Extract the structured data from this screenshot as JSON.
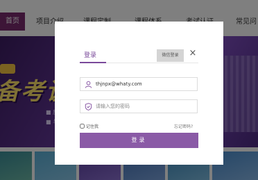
{
  "nav": {
    "home_label": "首页",
    "items": [
      "项目介绍",
      "课程定制",
      "课程体系",
      "考试认证",
      "常见问"
    ]
  },
  "banner": {
    "title": "备考谈",
    "bullets": [
      "■ 应",
      "■ 与"
    ]
  },
  "modal": {
    "tab_login": "登录",
    "wechat_label": "微信登录",
    "close_symbol": "×",
    "username_value": "thjnpx@whaty.com",
    "password_placeholder": "请输入您的密码",
    "remember_label": "记住我",
    "forgot_label": "忘记密码?",
    "submit_label": "登录"
  },
  "colors": {
    "accent": "#8a5aa6",
    "tab_accent": "#7a4a9a",
    "overlay": "rgba(0,0,0,0.5)"
  },
  "icons": {
    "username": "user-icon",
    "password": "shield-icon",
    "close": "close-icon"
  }
}
